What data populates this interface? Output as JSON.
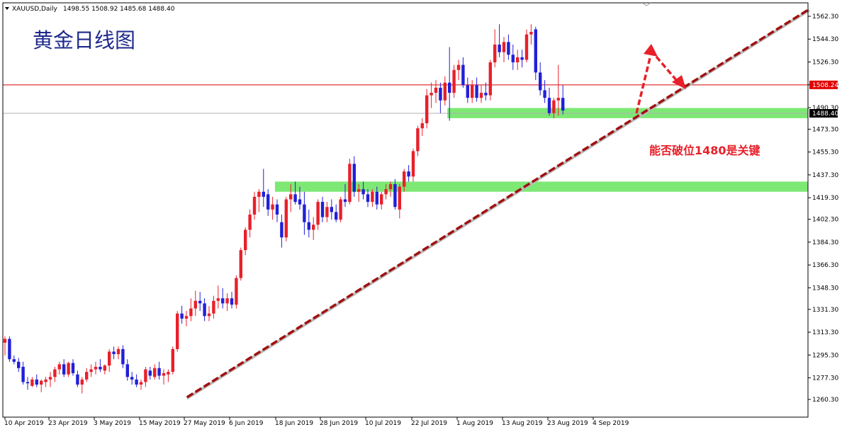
{
  "header": {
    "symbol": "XAUUSD,Daily",
    "ohlc": "1498.55 1508.92 1485.68 1488.40"
  },
  "title": "黄金日线图",
  "annotation": "能否破位1480是关键",
  "price_tags": {
    "resistance": "1508.24",
    "current": "1488.40"
  },
  "colors": {
    "bull": "#e8202a",
    "bear": "#2020d8",
    "trend": "#a01010",
    "zone": "#7de874",
    "hline": "#e00000",
    "text_blue": "#1f2a8c"
  },
  "chart_data": {
    "type": "candlestick",
    "title": "黄金日线图",
    "ylim": [
      1252,
      1572
    ],
    "y_ticks": [
      1562.3,
      1544.3,
      1526.3,
      1508.3,
      1490.3,
      1473.3,
      1455.3,
      1437.3,
      1419.3,
      1402.3,
      1384.3,
      1366.3,
      1348.3,
      1331.3,
      1313.3,
      1295.3,
      1277.3,
      1260.3
    ],
    "y_tick_labels": [
      "1562.30",
      "1544.30",
      "1526.30",
      "1508.30",
      "1490.30",
      "1473.30",
      "1455.30",
      "1437.30",
      "1419.30",
      "1402.30",
      "1384.30",
      "1366.30",
      "1348.30",
      "1331.30",
      "1313.30",
      "1295.30",
      "1277.30",
      "1260.30"
    ],
    "x_labels": [
      "10 Apr 2019",
      "23 Apr 2019",
      "3 May 2019",
      "15 May 2019",
      "27 May 2019",
      "6 Jun 2019",
      "18 Jun 2019",
      "28 Jun 2019",
      "10 Jul 2019",
      "22 Jul 2019",
      "1 Aug 2019",
      "13 Aug 2019",
      "23 Aug 2019",
      "4 Sep 2019"
    ],
    "candles": [
      {
        "o": 1305,
        "h": 1310,
        "l": 1295,
        "c": 1308
      },
      {
        "o": 1308,
        "h": 1310,
        "l": 1290,
        "c": 1292
      },
      {
        "o": 1292,
        "h": 1295,
        "l": 1288,
        "c": 1290
      },
      {
        "o": 1290,
        "h": 1293,
        "l": 1282,
        "c": 1285
      },
      {
        "o": 1286,
        "h": 1290,
        "l": 1272,
        "c": 1274
      },
      {
        "o": 1274,
        "h": 1278,
        "l": 1268,
        "c": 1273
      },
      {
        "o": 1271,
        "h": 1278,
        "l": 1270,
        "c": 1276
      },
      {
        "o": 1276,
        "h": 1280,
        "l": 1270,
        "c": 1272
      },
      {
        "o": 1272,
        "h": 1276,
        "l": 1266,
        "c": 1275
      },
      {
        "o": 1274,
        "h": 1278,
        "l": 1270,
        "c": 1276
      },
      {
        "o": 1276,
        "h": 1282,
        "l": 1270,
        "c": 1278
      },
      {
        "o": 1278,
        "h": 1286,
        "l": 1274,
        "c": 1284
      },
      {
        "o": 1284,
        "h": 1290,
        "l": 1280,
        "c": 1288
      },
      {
        "o": 1288,
        "h": 1292,
        "l": 1278,
        "c": 1280
      },
      {
        "o": 1280,
        "h": 1290,
        "l": 1278,
        "c": 1289
      },
      {
        "o": 1289,
        "h": 1292,
        "l": 1279,
        "c": 1281
      },
      {
        "o": 1280,
        "h": 1283,
        "l": 1270,
        "c": 1272
      },
      {
        "o": 1272,
        "h": 1278,
        "l": 1265,
        "c": 1276
      },
      {
        "o": 1276,
        "h": 1285,
        "l": 1274,
        "c": 1282
      },
      {
        "o": 1282,
        "h": 1288,
        "l": 1278,
        "c": 1284
      },
      {
        "o": 1284,
        "h": 1290,
        "l": 1280,
        "c": 1286
      },
      {
        "o": 1286,
        "h": 1292,
        "l": 1282,
        "c": 1284
      },
      {
        "o": 1283,
        "h": 1288,
        "l": 1280,
        "c": 1287
      },
      {
        "o": 1287,
        "h": 1300,
        "l": 1282,
        "c": 1298
      },
      {
        "o": 1298,
        "h": 1302,
        "l": 1292,
        "c": 1296
      },
      {
        "o": 1296,
        "h": 1302,
        "l": 1292,
        "c": 1300
      },
      {
        "o": 1300,
        "h": 1303,
        "l": 1285,
        "c": 1288
      },
      {
        "o": 1288,
        "h": 1292,
        "l": 1275,
        "c": 1278
      },
      {
        "o": 1278,
        "h": 1282,
        "l": 1272,
        "c": 1276
      },
      {
        "o": 1276,
        "h": 1280,
        "l": 1270,
        "c": 1272
      },
      {
        "o": 1272,
        "h": 1276,
        "l": 1268,
        "c": 1274
      },
      {
        "o": 1274,
        "h": 1286,
        "l": 1270,
        "c": 1284
      },
      {
        "o": 1283,
        "h": 1286,
        "l": 1276,
        "c": 1279
      },
      {
        "o": 1278,
        "h": 1288,
        "l": 1276,
        "c": 1285
      },
      {
        "o": 1285,
        "h": 1290,
        "l": 1276,
        "c": 1279
      },
      {
        "o": 1279,
        "h": 1284,
        "l": 1272,
        "c": 1281
      },
      {
        "o": 1280,
        "h": 1284,
        "l": 1274,
        "c": 1282
      },
      {
        "o": 1282,
        "h": 1302,
        "l": 1280,
        "c": 1300
      },
      {
        "o": 1300,
        "h": 1330,
        "l": 1298,
        "c": 1328
      },
      {
        "o": 1328,
        "h": 1334,
        "l": 1320,
        "c": 1324
      },
      {
        "o": 1324,
        "h": 1330,
        "l": 1318,
        "c": 1326
      },
      {
        "o": 1326,
        "h": 1340,
        "l": 1322,
        "c": 1332
      },
      {
        "o": 1332,
        "h": 1346,
        "l": 1326,
        "c": 1338
      },
      {
        "o": 1338,
        "h": 1345,
        "l": 1330,
        "c": 1336
      },
      {
        "o": 1336,
        "h": 1340,
        "l": 1322,
        "c": 1326
      },
      {
        "o": 1326,
        "h": 1334,
        "l": 1322,
        "c": 1328
      },
      {
        "o": 1328,
        "h": 1342,
        "l": 1324,
        "c": 1338
      },
      {
        "o": 1338,
        "h": 1350,
        "l": 1332,
        "c": 1340
      },
      {
        "o": 1340,
        "h": 1348,
        "l": 1332,
        "c": 1336
      },
      {
        "o": 1336,
        "h": 1344,
        "l": 1330,
        "c": 1340
      },
      {
        "o": 1340,
        "h": 1345,
        "l": 1332,
        "c": 1335
      },
      {
        "o": 1335,
        "h": 1358,
        "l": 1332,
        "c": 1356
      },
      {
        "o": 1356,
        "h": 1380,
        "l": 1354,
        "c": 1378
      },
      {
        "o": 1378,
        "h": 1396,
        "l": 1374,
        "c": 1394
      },
      {
        "o": 1394,
        "h": 1410,
        "l": 1388,
        "c": 1406
      },
      {
        "o": 1406,
        "h": 1424,
        "l": 1402,
        "c": 1420
      },
      {
        "o": 1420,
        "h": 1426,
        "l": 1408,
        "c": 1424
      },
      {
        "o": 1424,
        "h": 1442,
        "l": 1412,
        "c": 1420
      },
      {
        "o": 1422,
        "h": 1426,
        "l": 1405,
        "c": 1410
      },
      {
        "o": 1410,
        "h": 1420,
        "l": 1402,
        "c": 1414
      },
      {
        "o": 1414,
        "h": 1418,
        "l": 1400,
        "c": 1406
      },
      {
        "o": 1400,
        "h": 1406,
        "l": 1380,
        "c": 1388
      },
      {
        "o": 1388,
        "h": 1420,
        "l": 1385,
        "c": 1418
      },
      {
        "o": 1418,
        "h": 1430,
        "l": 1408,
        "c": 1422
      },
      {
        "o": 1422,
        "h": 1432,
        "l": 1414,
        "c": 1416
      },
      {
        "o": 1418,
        "h": 1428,
        "l": 1410,
        "c": 1414
      },
      {
        "o": 1414,
        "h": 1424,
        "l": 1390,
        "c": 1400
      },
      {
        "o": 1400,
        "h": 1410,
        "l": 1388,
        "c": 1394
      },
      {
        "o": 1394,
        "h": 1404,
        "l": 1386,
        "c": 1398
      },
      {
        "o": 1398,
        "h": 1418,
        "l": 1394,
        "c": 1416
      },
      {
        "o": 1416,
        "h": 1420,
        "l": 1400,
        "c": 1404
      },
      {
        "o": 1404,
        "h": 1416,
        "l": 1400,
        "c": 1412
      },
      {
        "o": 1412,
        "h": 1418,
        "l": 1402,
        "c": 1408
      },
      {
        "o": 1408,
        "h": 1414,
        "l": 1400,
        "c": 1402
      },
      {
        "o": 1402,
        "h": 1420,
        "l": 1400,
        "c": 1418
      },
      {
        "o": 1418,
        "h": 1430,
        "l": 1412,
        "c": 1416
      },
      {
        "o": 1416,
        "h": 1450,
        "l": 1414,
        "c": 1446
      },
      {
        "o": 1446,
        "h": 1452,
        "l": 1420,
        "c": 1424
      },
      {
        "o": 1424,
        "h": 1430,
        "l": 1416,
        "c": 1426
      },
      {
        "o": 1426,
        "h": 1432,
        "l": 1418,
        "c": 1422
      },
      {
        "o": 1422,
        "h": 1426,
        "l": 1412,
        "c": 1416
      },
      {
        "o": 1416,
        "h": 1426,
        "l": 1412,
        "c": 1424
      },
      {
        "o": 1424,
        "h": 1428,
        "l": 1410,
        "c": 1414
      },
      {
        "o": 1414,
        "h": 1424,
        "l": 1410,
        "c": 1422
      },
      {
        "o": 1422,
        "h": 1430,
        "l": 1418,
        "c": 1426
      },
      {
        "o": 1426,
        "h": 1432,
        "l": 1420,
        "c": 1430
      },
      {
        "o": 1430,
        "h": 1434,
        "l": 1410,
        "c": 1412
      },
      {
        "o": 1410,
        "h": 1430,
        "l": 1403,
        "c": 1428
      },
      {
        "o": 1428,
        "h": 1442,
        "l": 1424,
        "c": 1440
      },
      {
        "o": 1440,
        "h": 1445,
        "l": 1432,
        "c": 1436
      },
      {
        "o": 1436,
        "h": 1458,
        "l": 1432,
        "c": 1456
      },
      {
        "o": 1456,
        "h": 1476,
        "l": 1452,
        "c": 1474
      },
      {
        "o": 1474,
        "h": 1482,
        "l": 1468,
        "c": 1478
      },
      {
        "o": 1478,
        "h": 1505,
        "l": 1474,
        "c": 1500
      },
      {
        "o": 1500,
        "h": 1510,
        "l": 1490,
        "c": 1502
      },
      {
        "o": 1502,
        "h": 1512,
        "l": 1494,
        "c": 1506
      },
      {
        "o": 1506,
        "h": 1510,
        "l": 1486,
        "c": 1496
      },
      {
        "o": 1496,
        "h": 1515,
        "l": 1492,
        "c": 1510
      },
      {
        "o": 1510,
        "h": 1538,
        "l": 1480,
        "c": 1502
      },
      {
        "o": 1502,
        "h": 1524,
        "l": 1498,
        "c": 1520
      },
      {
        "o": 1520,
        "h": 1528,
        "l": 1512,
        "c": 1524
      },
      {
        "o": 1524,
        "h": 1530,
        "l": 1506,
        "c": 1508
      },
      {
        "o": 1508,
        "h": 1514,
        "l": 1494,
        "c": 1498
      },
      {
        "o": 1498,
        "h": 1512,
        "l": 1494,
        "c": 1508
      },
      {
        "o": 1508,
        "h": 1514,
        "l": 1495,
        "c": 1498
      },
      {
        "o": 1498,
        "h": 1508,
        "l": 1494,
        "c": 1502
      },
      {
        "o": 1502,
        "h": 1510,
        "l": 1496,
        "c": 1500
      },
      {
        "o": 1500,
        "h": 1528,
        "l": 1496,
        "c": 1526
      },
      {
        "o": 1526,
        "h": 1552,
        "l": 1522,
        "c": 1540
      },
      {
        "o": 1540,
        "h": 1556,
        "l": 1530,
        "c": 1534
      },
      {
        "o": 1534,
        "h": 1546,
        "l": 1526,
        "c": 1542
      },
      {
        "o": 1542,
        "h": 1548,
        "l": 1528,
        "c": 1532
      },
      {
        "o": 1532,
        "h": 1540,
        "l": 1520,
        "c": 1526
      },
      {
        "o": 1526,
        "h": 1536,
        "l": 1520,
        "c": 1530
      },
      {
        "o": 1530,
        "h": 1536,
        "l": 1522,
        "c": 1528
      },
      {
        "o": 1528,
        "h": 1552,
        "l": 1526,
        "c": 1548
      },
      {
        "o": 1548,
        "h": 1556,
        "l": 1540,
        "c": 1550
      },
      {
        "o": 1552,
        "h": 1554,
        "l": 1512,
        "c": 1518
      },
      {
        "o": 1518,
        "h": 1526,
        "l": 1500,
        "c": 1504
      },
      {
        "o": 1504,
        "h": 1512,
        "l": 1494,
        "c": 1498
      },
      {
        "o": 1498,
        "h": 1506,
        "l": 1484,
        "c": 1486
      },
      {
        "o": 1486,
        "h": 1498,
        "l": 1482,
        "c": 1496
      },
      {
        "o": 1496,
        "h": 1524,
        "l": 1484,
        "c": 1498
      },
      {
        "o": 1498,
        "h": 1508,
        "l": 1485,
        "c": 1488
      }
    ],
    "horizontal_lines": [
      {
        "price": 1508.24,
        "label": "1508.24"
      },
      {
        "price": 1490.3,
        "label": "1488.40"
      }
    ],
    "support_zones": [
      {
        "from_candle": 98,
        "top": 1490,
        "bottom": 1482
      },
      {
        "from_candle": 60,
        "top": 1432,
        "bottom": 1424
      }
    ],
    "trendline": {
      "from_candle": 37,
      "from_price": 1262,
      "to_candle": 150,
      "to_price": 1568
    }
  }
}
